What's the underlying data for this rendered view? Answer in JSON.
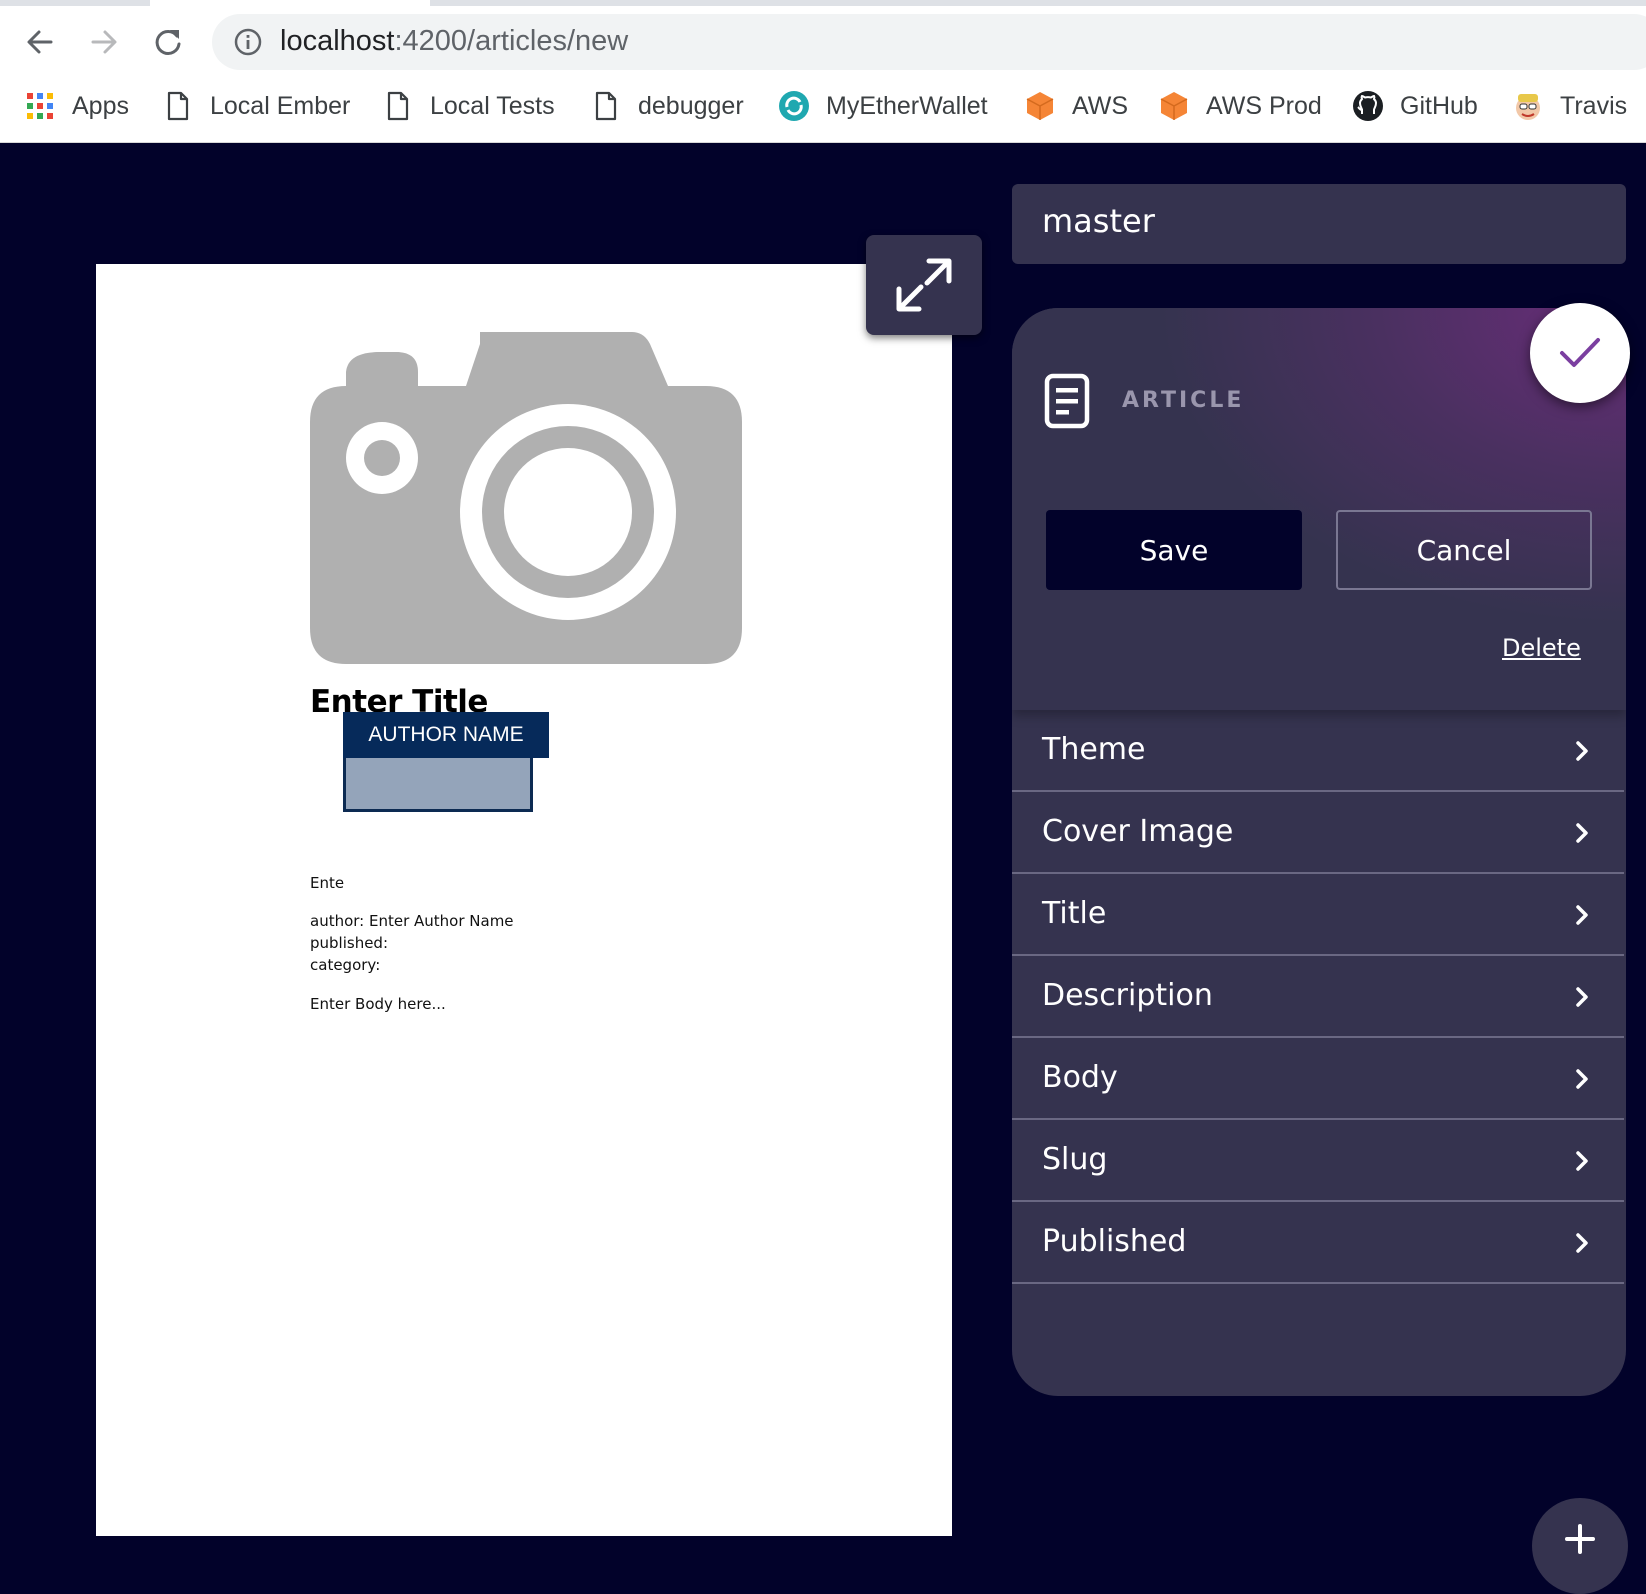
{
  "browser": {
    "url_host": "localhost",
    "url_path": ":4200/articles/new",
    "bookmarks": [
      {
        "label": "Apps",
        "icon": "apps-grid-icon"
      },
      {
        "label": "Local Ember",
        "icon": "page-icon"
      },
      {
        "label": "Local Tests",
        "icon": "page-icon"
      },
      {
        "label": "debugger",
        "icon": "page-icon"
      },
      {
        "label": "MyEtherWallet",
        "icon": "myetherwallet-icon"
      },
      {
        "label": "AWS",
        "icon": "aws-cube-icon"
      },
      {
        "label": "AWS Prod",
        "icon": "aws-cube-icon"
      },
      {
        "label": "GitHub",
        "icon": "github-icon"
      },
      {
        "label": "Travis",
        "icon": "travis-icon"
      }
    ]
  },
  "preview": {
    "title": "Enter Title",
    "description_partial": "Ente",
    "author_line": "author: Enter Author Name",
    "published_line": "published:",
    "category_line": "category:",
    "body": "Enter Body here...",
    "author_tag": "AUTHOR NAME"
  },
  "editor": {
    "branch": "master",
    "type_label": "ARTICLE",
    "save_label": "Save",
    "cancel_label": "Cancel",
    "delete_label": "Delete",
    "menu": [
      {
        "label": "Theme"
      },
      {
        "label": "Cover Image"
      },
      {
        "label": "Title"
      },
      {
        "label": "Description"
      },
      {
        "label": "Body"
      },
      {
        "label": "Slug"
      },
      {
        "label": "Published"
      }
    ]
  },
  "colors": {
    "app_background": "#02022a",
    "panel": "#35334f",
    "accent_purple": "#7b3fa0",
    "author_tag": "#062a5a"
  }
}
